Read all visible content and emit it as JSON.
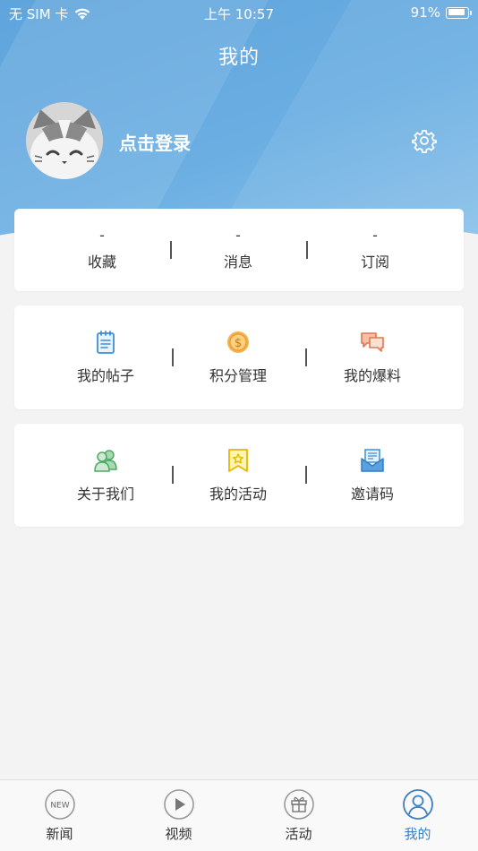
{
  "status_bar": {
    "carrier": "无 SIM 卡",
    "time": "上午 10:57",
    "battery_text": "91%",
    "battery_level": 0.91
  },
  "header": {
    "title": "我的"
  },
  "profile": {
    "login_label": "点击登录",
    "avatar_icon": "cat-avatar-icon",
    "settings_icon": "gear-icon"
  },
  "stats": [
    {
      "value": "-",
      "label": "收藏"
    },
    {
      "value": "-",
      "label": "消息"
    },
    {
      "value": "-",
      "label": "订阅"
    }
  ],
  "menu_rows": [
    [
      {
        "label": "我的帖子",
        "icon": "notepad-icon"
      },
      {
        "label": "积分管理",
        "icon": "coin-icon"
      },
      {
        "label": "我的爆料",
        "icon": "chat-bubbles-icon"
      }
    ],
    [
      {
        "label": "关于我们",
        "icon": "people-icon"
      },
      {
        "label": "我的活动",
        "icon": "bookmark-star-icon"
      },
      {
        "label": "邀请码",
        "icon": "envelope-icon"
      }
    ]
  ],
  "tabbar": {
    "tabs": [
      {
        "label": "新闻",
        "icon": "new-badge-icon",
        "icon_text": "NEW"
      },
      {
        "label": "视频",
        "icon": "play-icon"
      },
      {
        "label": "活动",
        "icon": "gift-icon"
      },
      {
        "label": "我的",
        "icon": "user-icon"
      }
    ],
    "active_index": 3
  },
  "colors": {
    "header_blue": "#5fa4dc",
    "active_tab": "#3b7fc4",
    "background": "#f3f3f3"
  }
}
